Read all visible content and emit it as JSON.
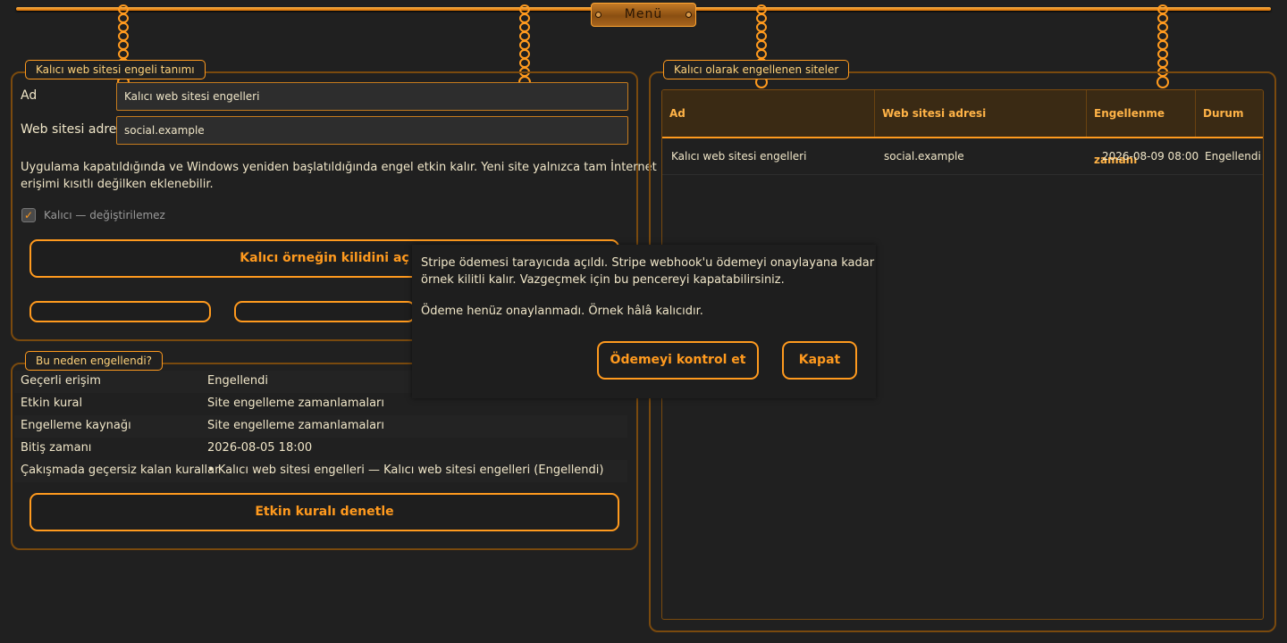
{
  "menu": {
    "label": "Menü"
  },
  "definition_panel": {
    "title": "Kalıcı web sitesi engeli tanımı",
    "name_label": "Ad",
    "name_value": "Kalıcı web sitesi engelleri",
    "url_label": "Web sitesi adresi",
    "url_value": "social.example",
    "info_line1": "Uygulama kapatıldığında ve Windows yeniden başlatıldığında engel etkin kalır. Yeni site yalnızca tam İnternet",
    "info_line2": "erişimi kısıtlı değilken eklenebilir.",
    "permanent_checkbox_label": "Kalıcı — değiştirilemez",
    "permanent_checked": true,
    "unlock_button": "Kalıcı örneğin kilidini aç"
  },
  "why_panel": {
    "title": "Bu neden engellendi?",
    "rows": [
      {
        "label": "Geçerli erişim",
        "value": "Engellendi"
      },
      {
        "label": "Etkin kural",
        "value": "Site engelleme zamanlamaları"
      },
      {
        "label": "Engelleme kaynağı",
        "value": "Site engelleme zamanlamaları"
      },
      {
        "label": "Bitiş zamanı",
        "value": "2026-08-05 18:00"
      },
      {
        "label": "Çakışmada geçersiz kalan kurallar",
        "value": "• Kalıcı web sitesi engelleri — Kalıcı web sitesi engelleri (Engellendi)"
      }
    ],
    "inspect_button": "Etkin kuralı denetle"
  },
  "blocked_sites_panel": {
    "title": "Kalıcı olarak engellenen siteler",
    "columns": [
      "Ad",
      "Web sitesi adresi",
      "Engellenme zamanı",
      "Durum"
    ],
    "rows": [
      {
        "name": "Kalıcı web sitesi engelleri",
        "url": "social.example",
        "time": "2026-08-09 08:00",
        "status": "Engellendi"
      }
    ]
  },
  "payment_dialog": {
    "line1": "Stripe ödemesi tarayıcıda açıldı. Stripe webhook'u ödemeyi onaylayana kadar",
    "line2": "örnek kilitli kalır. Vazgeçmek için bu pencereyi kapatabilirsiniz.",
    "status": "Ödeme henüz onaylanmadı. Örnek hâlâ kalıcıdır.",
    "check_button": "Ödemeyi kontrol et",
    "close_button": "Kapat"
  },
  "colors": {
    "accent": "#ff9a1e",
    "background": "#202020",
    "text": "#f0e6c8",
    "header_bg": "#3a2a14"
  }
}
